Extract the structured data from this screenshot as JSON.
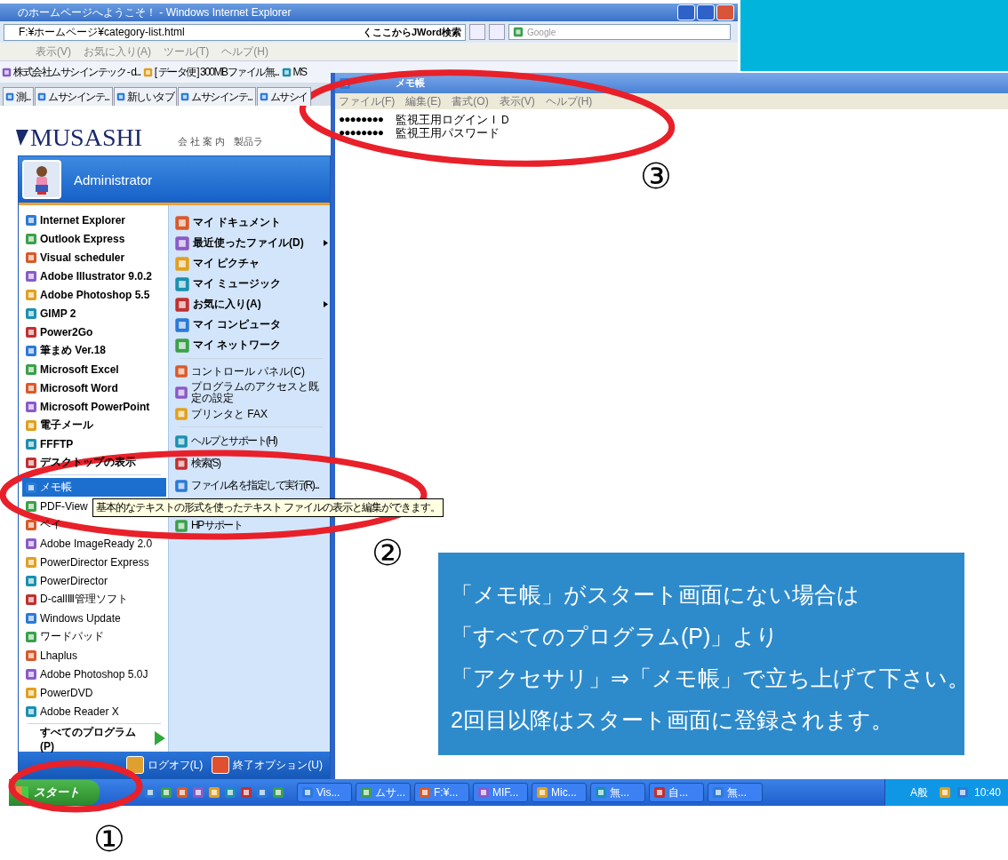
{
  "browser": {
    "title": "のホームページへようこそ！ - Windows Internet Explorer",
    "address": "F:¥ホームページ¥category-list.html",
    "search_link": "くここからJWord検索",
    "search_placeholder": "Google",
    "menu": [
      "表示(V)",
      "お気に入り(A)",
      "ツール(T)",
      "ヘルプ(H)"
    ],
    "favorites": [
      "株式会社ムサシインテック - d...",
      "[ データ便 ] 300MBファイル無...",
      "MS"
    ],
    "tabs": [
      {
        "label": "測...",
        "selected": false
      },
      {
        "label": "ムサシインテ...",
        "selected": false
      },
      {
        "label": "新しいタブ",
        "selected": false
      },
      {
        "label": "ムサシインテ...",
        "selected": false
      },
      {
        "label": "ムサシイ",
        "selected": false
      }
    ],
    "logo": "MUSASHI",
    "page_links": [
      "会 社 案 内",
      "製品ラ"
    ]
  },
  "notepad": {
    "title": "メモ帳",
    "menu": [
      "ファイル(F)",
      "編集(E)",
      "書式(O)",
      "表示(V)",
      "ヘルプ(H)"
    ],
    "lines": [
      {
        "mask": "●●●●●●●●",
        "label": "監視王用ログインＩＤ"
      },
      {
        "mask": "●●●●●●●●",
        "label": "監視王用パスワード"
      }
    ]
  },
  "start_menu": {
    "user": "Administrator",
    "programs": [
      {
        "label": "Internet Explorer",
        "kind": "pinned",
        "selected": false
      },
      {
        "label": "Outlook Express",
        "kind": "pinned",
        "selected": false
      },
      {
        "label": "Visual scheduler",
        "kind": "pinned",
        "selected": false
      },
      {
        "label": "Adobe Illustrator 9.0.2",
        "kind": "pinned",
        "selected": false
      },
      {
        "label": "Adobe Photoshop 5.5",
        "kind": "pinned",
        "selected": false
      },
      {
        "label": "GIMP 2",
        "kind": "pinned",
        "selected": false
      },
      {
        "label": "Power2Go",
        "kind": "pinned",
        "selected": false
      },
      {
        "label": "筆まめ Ver.18",
        "kind": "pinned",
        "selected": false
      },
      {
        "label": "Microsoft Excel",
        "kind": "pinned",
        "selected": false
      },
      {
        "label": "Microsoft Word",
        "kind": "pinned",
        "selected": false
      },
      {
        "label": "Microsoft PowerPoint",
        "kind": "pinned",
        "selected": false
      },
      {
        "label": "電子メール",
        "kind": "pinned",
        "selected": false
      },
      {
        "label": "FFFTP",
        "kind": "pinned",
        "selected": false
      },
      {
        "label": "デスクトップの表示",
        "kind": "pinned",
        "selected": false
      },
      {
        "label": "メモ帳",
        "kind": "recent",
        "selected": true
      },
      {
        "label": "PDF-View",
        "kind": "recent",
        "selected": false
      },
      {
        "label": "ペイ",
        "kind": "recent",
        "selected": false
      },
      {
        "label": "Adobe ImageReady 2.0",
        "kind": "recent",
        "selected": false
      },
      {
        "label": "PowerDirector Express",
        "kind": "recent",
        "selected": false
      },
      {
        "label": "PowerDirector",
        "kind": "recent",
        "selected": false
      },
      {
        "label": "D-callⅢ管理ソフト",
        "kind": "recent",
        "selected": false
      },
      {
        "label": "Windows Update",
        "kind": "recent",
        "selected": false
      },
      {
        "label": "ワードパッド",
        "kind": "recent",
        "selected": false
      },
      {
        "label": "Lhaplus",
        "kind": "recent",
        "selected": false
      },
      {
        "label": "Adobe Photoshop 5.0J",
        "kind": "recent",
        "selected": false
      },
      {
        "label": "PowerDVD",
        "kind": "recent",
        "selected": false
      },
      {
        "label": "Adobe Reader X",
        "kind": "recent",
        "selected": false
      }
    ],
    "all_programs": "すべてのプログラム(P)",
    "places": [
      {
        "label": "マイ ドキュメント",
        "kind": "main",
        "submenu": false
      },
      {
        "label": "最近使ったファイル(D)",
        "kind": "main",
        "submenu": true
      },
      {
        "label": "マイ ピクチャ",
        "kind": "main",
        "submenu": false
      },
      {
        "label": "マイ ミュージック",
        "kind": "main",
        "submenu": false
      },
      {
        "label": "お気に入り(A)",
        "kind": "main",
        "submenu": true
      },
      {
        "label": "マイ コンピュータ",
        "kind": "main",
        "submenu": false
      },
      {
        "label": "マイ ネットワーク",
        "kind": "main",
        "submenu": false
      },
      {
        "label": "コントロール パネル(C)",
        "kind": "system",
        "submenu": false
      },
      {
        "label": "プログラムのアクセスと既定の設定",
        "kind": "system",
        "submenu": false
      },
      {
        "label": "プリンタと FAX",
        "kind": "system",
        "submenu": false
      },
      {
        "label": "ヘルプとサポート(H)",
        "kind": "tool",
        "submenu": false
      },
      {
        "label": "検索(S)",
        "kind": "tool",
        "submenu": false
      },
      {
        "label": "ファイル名を指定して実行(R)...",
        "kind": "tool",
        "submenu": false
      },
      {
        "label": "HP サポート",
        "kind": "tool",
        "submenu": false
      }
    ],
    "logoff": "ログオフ(L)",
    "shutdown": "終了オプション(U)",
    "tooltip": "基本的なテキストの形式を使ったテキスト ファイルの表示と編集ができます。"
  },
  "taskbar": {
    "start": "スタート",
    "tasks": [
      "Vis...",
      "ムサ...",
      "F:¥...",
      "MIF...",
      "Mic...",
      "無...",
      "自...",
      "無..."
    ],
    "ime": "A般",
    "clock": "10:40"
  },
  "callout": {
    "lines": [
      "「メモ帳」がスタート画面にない場合は",
      "「すべてのプログラム(P)」より",
      "「アクセサリ」⇒「メモ帳」で立ち上げて下さい。",
      "2回目以降はスタート画面に登録されます。"
    ]
  },
  "markers": [
    "①",
    "②",
    "③"
  ]
}
